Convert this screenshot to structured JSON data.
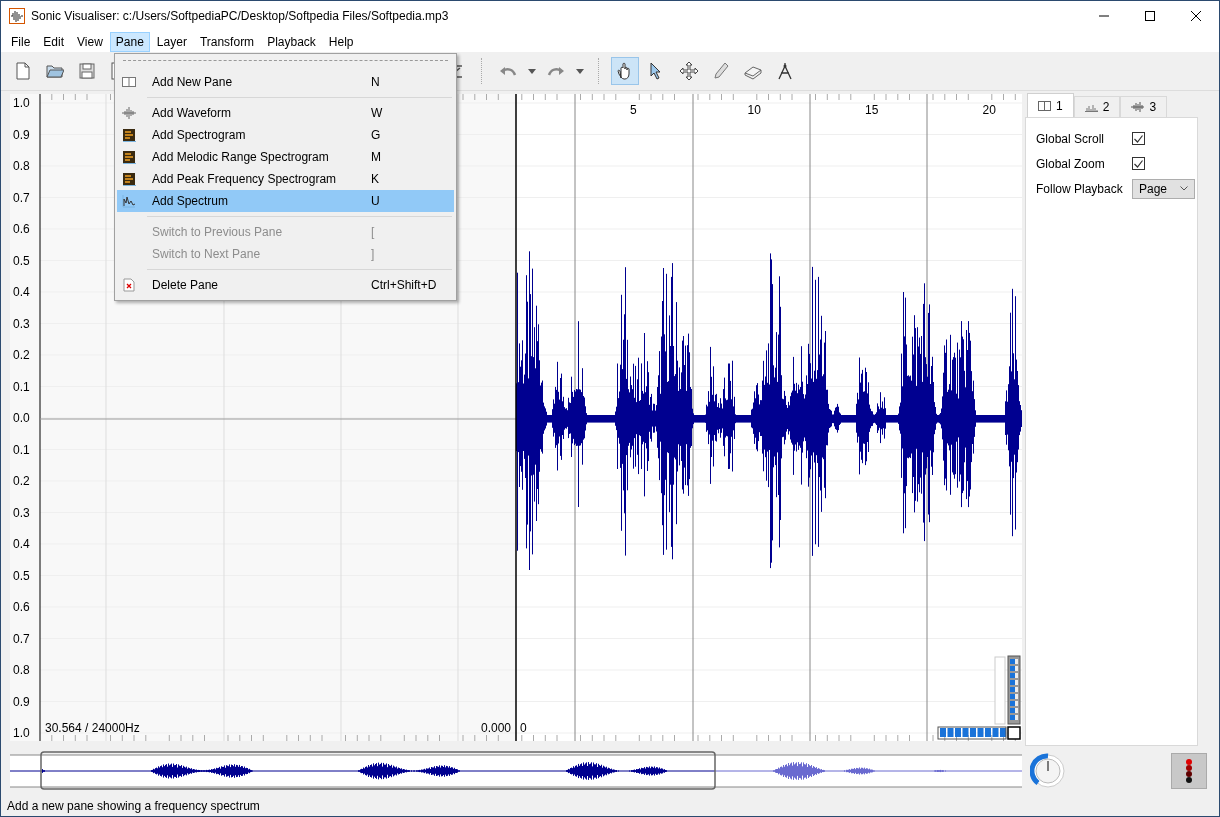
{
  "window": {
    "title": "Sonic Visualiser: c:/Users/SoftpediaPC/Desktop/Softpedia Files/Softpedia.mp3"
  },
  "menubar": [
    {
      "label": "File",
      "selected": false
    },
    {
      "label": "Edit",
      "selected": false
    },
    {
      "label": "View",
      "selected": false
    },
    {
      "label": "Pane",
      "selected": true
    },
    {
      "label": "Layer",
      "selected": false
    },
    {
      "label": "Transform",
      "selected": false
    },
    {
      "label": "Playback",
      "selected": false
    },
    {
      "label": "Help",
      "selected": false
    }
  ],
  "toolbar": {
    "tools": [
      {
        "kind": "navigate",
        "selected": true
      },
      {
        "kind": "select",
        "selected": false
      },
      {
        "kind": "move",
        "selected": false
      },
      {
        "kind": "draw",
        "selected": false
      },
      {
        "kind": "erase",
        "selected": false
      },
      {
        "kind": "measure",
        "selected": false
      }
    ]
  },
  "menu": {
    "items": [
      {
        "kind": "pane",
        "label": "Add New Pane",
        "shortcut": "N",
        "disabled": false,
        "selected": false
      },
      {
        "kind": "separator"
      },
      {
        "kind": "waveform",
        "label": "Add Waveform",
        "shortcut": "W",
        "disabled": false,
        "selected": false
      },
      {
        "kind": "spectrogram",
        "label": "Add Spectrogram",
        "shortcut": "G",
        "disabled": false,
        "selected": false
      },
      {
        "kind": "spectrogram",
        "label": "Add Melodic Range Spectrogram",
        "shortcut": "M",
        "disabled": false,
        "selected": false
      },
      {
        "kind": "spectrogram",
        "label": "Add Peak Frequency Spectrogram",
        "shortcut": "K",
        "disabled": false,
        "selected": false
      },
      {
        "kind": "spectrum",
        "label": "Add Spectrum",
        "shortcut": "U",
        "disabled": false,
        "selected": true
      },
      {
        "kind": "separator"
      },
      {
        "kind": "plain",
        "label": "Switch to Previous Pane",
        "shortcut": "[",
        "disabled": true,
        "selected": false
      },
      {
        "kind": "plain",
        "label": "Switch to Next Pane",
        "shortcut": "]",
        "disabled": true,
        "selected": false
      },
      {
        "kind": "separator"
      },
      {
        "kind": "delete",
        "label": "Delete Pane",
        "shortcut": "Ctrl+Shift+D",
        "disabled": false,
        "selected": false
      }
    ]
  },
  "pane": {
    "y_axis_labels": [
      "1.0",
      "0.9",
      "0.8",
      "0.7",
      "0.6",
      "0.5",
      "0.4",
      "0.3",
      "0.2",
      "0.1",
      "0.0",
      "0.1",
      "0.2",
      "0.3",
      "0.4",
      "0.5",
      "0.6",
      "0.7",
      "0.8",
      "0.9",
      "1.0"
    ],
    "ruler_labels": [
      "5",
      "10",
      "15",
      "20"
    ],
    "duration_info": "30.564 / 24000Hz",
    "position_info": "0.000",
    "playhead_label": "0"
  },
  "side_panel": {
    "tabs": [
      {
        "kind": "pane",
        "label": "1",
        "selected": true
      },
      {
        "kind": "spectrum",
        "label": "2",
        "selected": false
      },
      {
        "kind": "waveform",
        "label": "3",
        "selected": false
      }
    ],
    "options": [
      {
        "kind": "checkbox",
        "label": "Global Scroll",
        "checked": true
      },
      {
        "kind": "checkbox",
        "label": "Global Zoom",
        "checked": true
      },
      {
        "kind": "select",
        "label": "Follow Playback",
        "value": "Page"
      }
    ]
  },
  "status_bar": {
    "text": "Add a new pane showing a frequency spectrum"
  }
}
